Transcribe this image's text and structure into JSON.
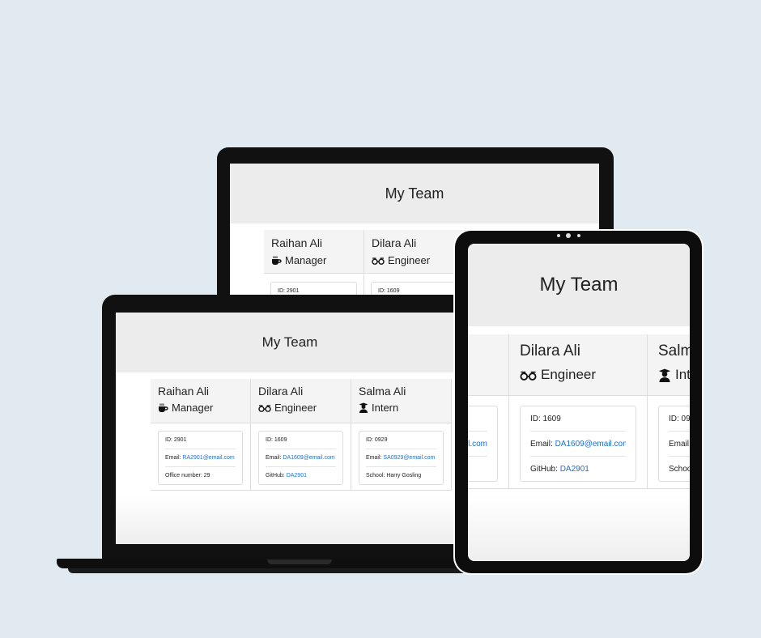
{
  "page": {
    "title": "My Team"
  },
  "team": [
    {
      "name": "Raihan Ali",
      "role": "Manager",
      "role_icon": "coffee-icon",
      "id": "ID: 2901",
      "email_label": "Email: ",
      "email": "RA2901@email.com",
      "extra_label": "Office number: ",
      "extra_value": "29"
    },
    {
      "name": "Dilara Ali",
      "role": "Engineer",
      "role_icon": "glasses-icon",
      "id": "ID: 1609",
      "email_label": "Email: ",
      "email": "DA1609@email.com",
      "extra_label": "GitHub: ",
      "extra_value": "DA2901"
    },
    {
      "name": "Salma Ali",
      "role": "Intern",
      "role_icon": "graduate-icon",
      "id": "ID: 0929",
      "email_label": "Email: ",
      "email": "SA0929@email.com",
      "extra_label": "School: ",
      "extra_value": "Harry Gosling"
    }
  ],
  "tablet_partial": {
    "name": "Salm",
    "role": "Int",
    "id": "ID: 09",
    "email_label": "Email:",
    "extra_label": "Schoo"
  },
  "colors": {
    "background": "#e1e9f1",
    "header": "#ececec",
    "link": "#1c6fd1",
    "device": "#111111"
  }
}
